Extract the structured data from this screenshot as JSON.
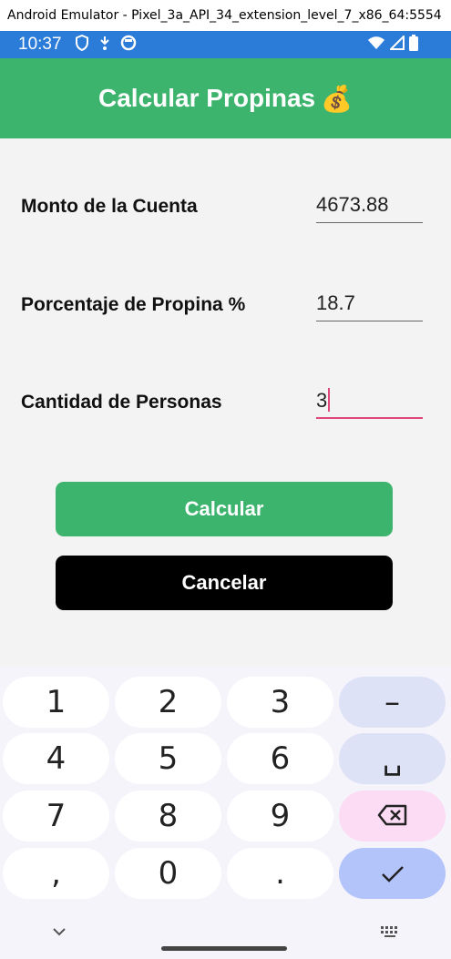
{
  "window": {
    "title": "Android Emulator - Pixel_3a_API_34_extension_level_7_x86_64:5554"
  },
  "statusbar": {
    "time": "10:37",
    "left_icons": [
      "shield-icon",
      "download-icon",
      "circle-icon"
    ],
    "right_icons": [
      "wifi-icon",
      "signal-icon",
      "battery-icon"
    ],
    "color": "#2b7bd8"
  },
  "appbar": {
    "title": "Calcular Propinas",
    "emoji": "💰",
    "color": "#3db46d"
  },
  "form": {
    "rows": [
      {
        "label": "Monto de la Cuenta",
        "value": "4673.88"
      },
      {
        "label": "Porcentaje de Propina %",
        "value": "18.7"
      },
      {
        "label": "Cantidad de Personas",
        "value": "3",
        "focused": true
      }
    ],
    "accent_color": "#e0457b"
  },
  "buttons": {
    "calcular": {
      "label": "Calcular",
      "color": "#3db46d"
    },
    "cancelar": {
      "label": "Cancelar",
      "color": "#000000"
    }
  },
  "keyboard": {
    "keys": [
      [
        "1",
        "2",
        "3",
        "–"
      ],
      [
        "4",
        "5",
        "6",
        "␣"
      ],
      [
        "7",
        "8",
        "9",
        "⌫"
      ],
      [
        ",",
        "0",
        ".",
        "✓"
      ]
    ],
    "nav": {
      "collapse_icon": "chevron-down-icon",
      "switch_icon": "keyboard-icon"
    }
  }
}
